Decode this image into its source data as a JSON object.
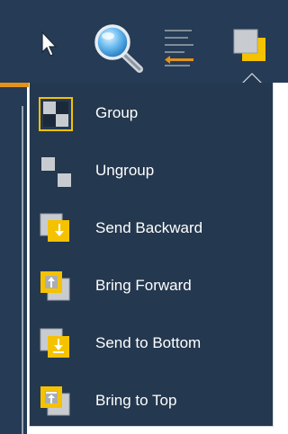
{
  "toolbar": {
    "icons": [
      "pointer-icon",
      "search-icon",
      "align-icon",
      "arrange-icon"
    ]
  },
  "menu": {
    "items": [
      {
        "label": "Group",
        "icon": "group-icon"
      },
      {
        "label": "Ungroup",
        "icon": "ungroup-icon"
      },
      {
        "label": "Send Backward",
        "icon": "send-backward-icon"
      },
      {
        "label": "Bring Forward",
        "icon": "bring-forward-icon"
      },
      {
        "label": "Send to Bottom",
        "icon": "send-to-bottom-icon"
      },
      {
        "label": "Bring to Top",
        "icon": "bring-to-top-icon"
      }
    ]
  },
  "colors": {
    "background": "#263B55",
    "menu_background": "#24384F",
    "accent": "#F5C200",
    "separator": "#E3931A",
    "text": "#FFFFFF"
  }
}
